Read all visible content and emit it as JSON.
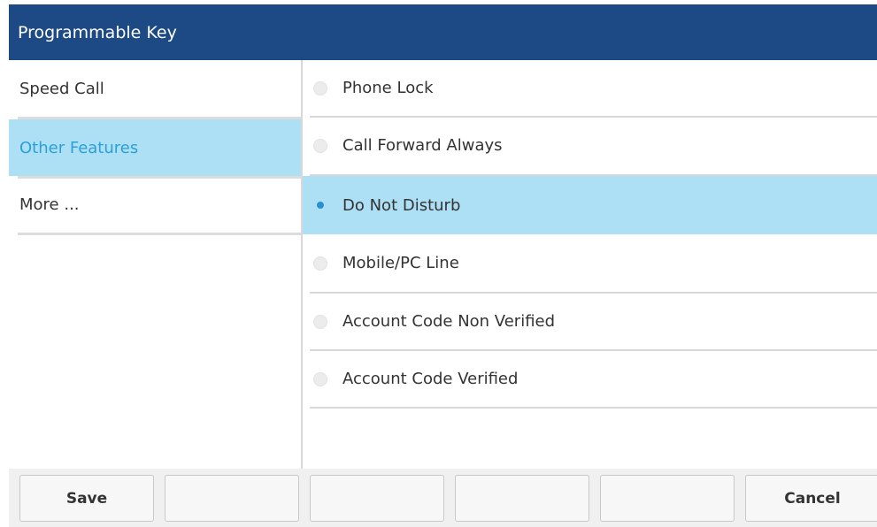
{
  "header": {
    "title": "Programmable Key"
  },
  "categories": {
    "selected_index": 1,
    "items": [
      {
        "label": "Speed Call"
      },
      {
        "label": "Other Features"
      },
      {
        "label": "More ..."
      }
    ]
  },
  "options": {
    "selected_index": 2,
    "items": [
      {
        "label": "Phone Lock"
      },
      {
        "label": "Call Forward Always"
      },
      {
        "label": "Do Not Disturb"
      },
      {
        "label": "Mobile/PC Line"
      },
      {
        "label": "Account Code Non Verified"
      },
      {
        "label": "Account Code Verified"
      }
    ]
  },
  "softkeys": [
    {
      "label": "Save"
    },
    {
      "label": ""
    },
    {
      "label": ""
    },
    {
      "label": ""
    },
    {
      "label": ""
    },
    {
      "label": "Cancel"
    }
  ],
  "colors": {
    "title_bar": "#1d4a85",
    "selection_background": "#aee0f5",
    "selected_text": "#2aa0d8",
    "radio_selected": "#2a8fd0"
  }
}
